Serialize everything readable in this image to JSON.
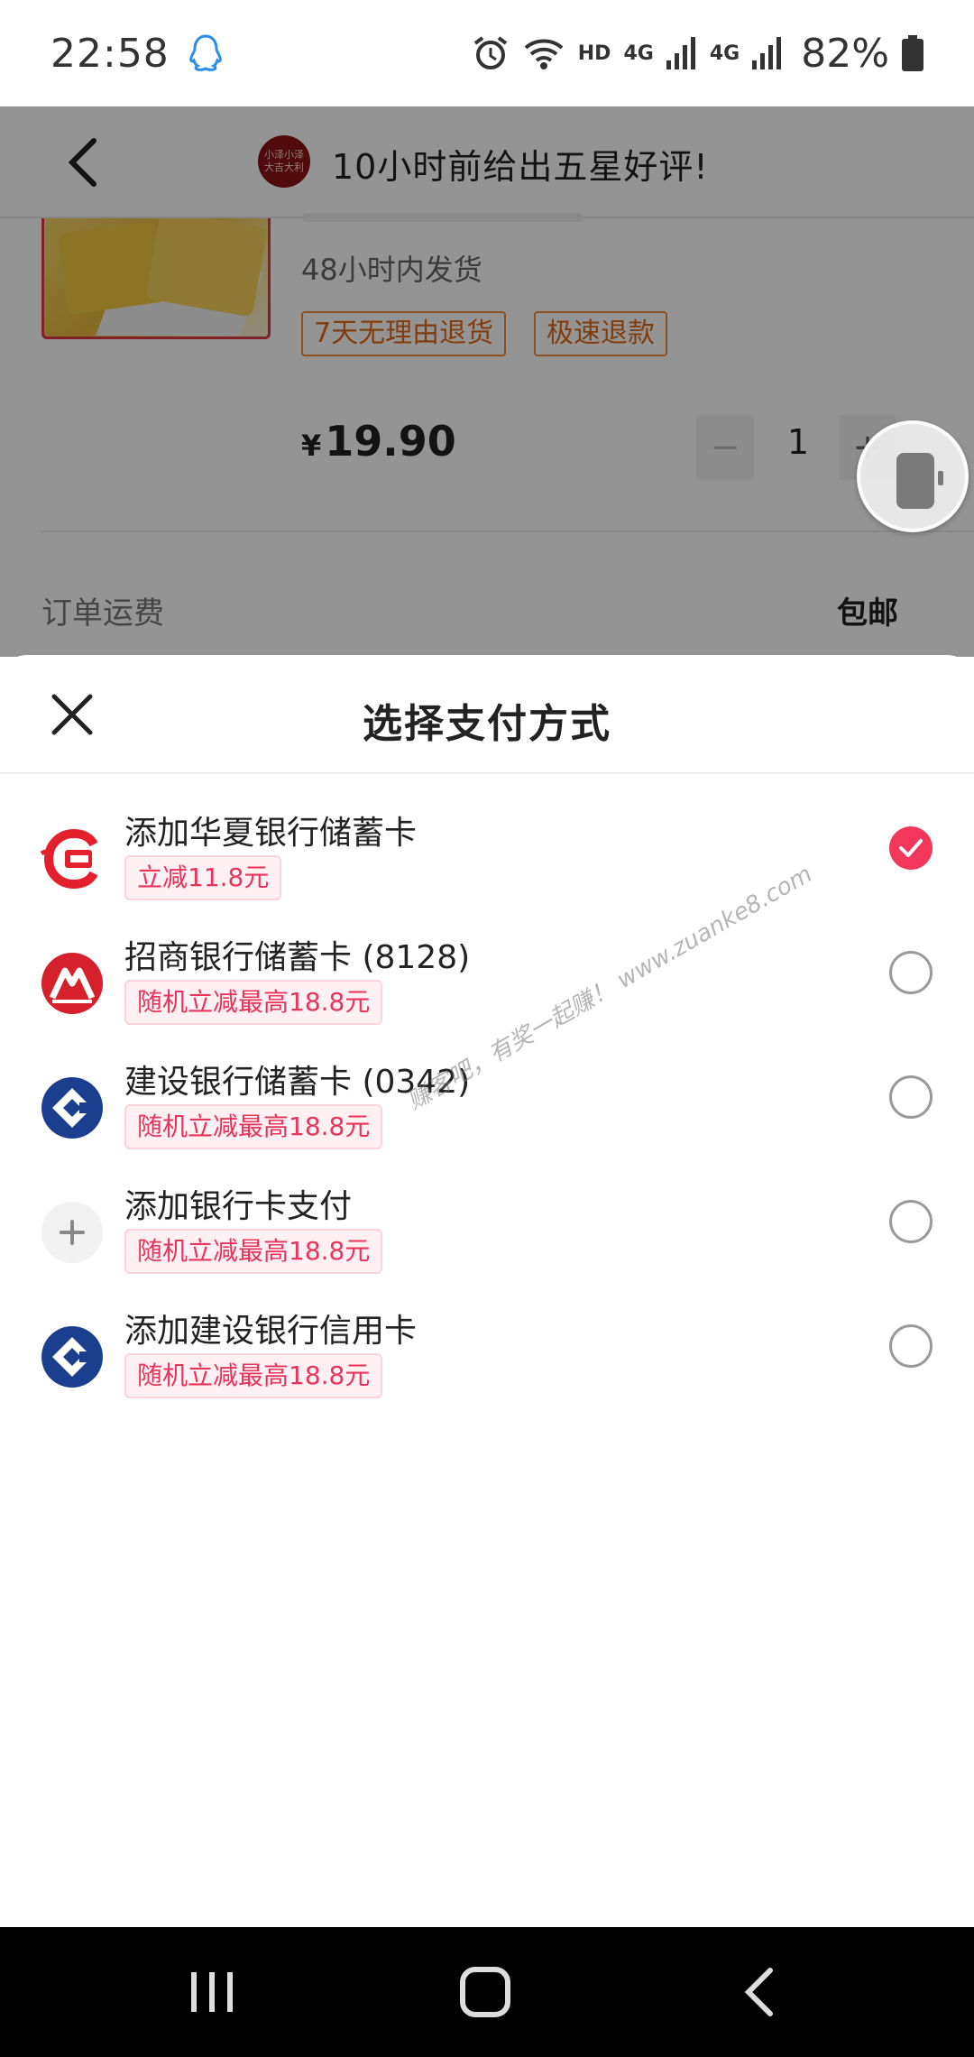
{
  "status_bar": {
    "time": "22:58",
    "hd": "HD",
    "net1": "4G",
    "net2": "4G",
    "battery": "82%"
  },
  "app_bar": {
    "shop_logo_text": "小泽小泽 大吉大利",
    "title": "10小时前给出五星好评!"
  },
  "product": {
    "ship_time": "48小时内发货",
    "tags": [
      "7天无理由退货",
      "极速退款"
    ],
    "currency": "¥",
    "price": "19.90",
    "quantity": "1",
    "minus": "−",
    "plus": "+"
  },
  "freight": {
    "label": "订单运费",
    "value": "包邮"
  },
  "sheet": {
    "title": "选择支付方式",
    "methods": [
      {
        "name": "添加华夏银行储蓄卡",
        "promo": "立减11.8元",
        "icon": "huaxia-bank-icon",
        "selected": true
      },
      {
        "name": "招商银行储蓄卡 (8128)",
        "promo": "随机立减最高18.8元",
        "icon": "cmb-bank-icon",
        "selected": false
      },
      {
        "name": "建设银行储蓄卡 (0342)",
        "promo": "随机立减最高18.8元",
        "icon": "ccb-bank-icon",
        "selected": false
      },
      {
        "name": "添加银行卡支付",
        "promo": "随机立减最高18.8元",
        "icon": "plus-icon",
        "selected": false
      },
      {
        "name": "添加建设银行信用卡",
        "promo": "随机立减最高18.8元",
        "icon": "ccb-bank-icon",
        "selected": false
      }
    ]
  },
  "watermark": "赚客吧，有奖一起赚！ www.zuanke8.com",
  "colors": {
    "accent": "#f2375a",
    "promo_text": "#e8335a",
    "tag_orange": "#e06a1a",
    "huaxia_red": "#e3202c",
    "cmb_red": "#d6202b",
    "ccb_blue": "#1b3f8f"
  }
}
